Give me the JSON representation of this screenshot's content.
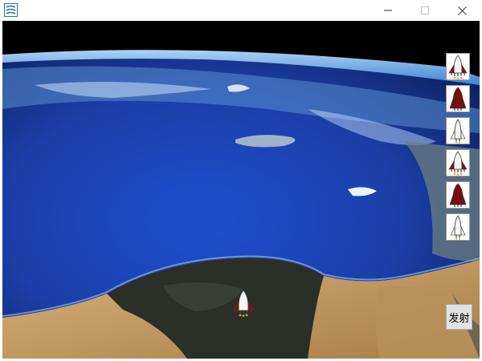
{
  "window": {
    "title": "",
    "icon": "app-icon",
    "controls": [
      "minimize-icon",
      "maximize-icon",
      "close-icon"
    ]
  },
  "enemy_ships": [
    {
      "icon": "shuttle-icon",
      "variant": "white-red"
    },
    {
      "icon": "shuttle-icon",
      "variant": "dark-red"
    },
    {
      "icon": "shuttle-icon",
      "variant": "white"
    },
    {
      "icon": "shuttle-icon",
      "variant": "white-red"
    },
    {
      "icon": "shuttle-icon",
      "variant": "dark-red"
    },
    {
      "icon": "shuttle-icon",
      "variant": "white"
    }
  ],
  "player_ship": {
    "icon": "shuttle-icon",
    "variant": "white-red"
  },
  "fire_button": {
    "label": "发射"
  },
  "colors": {
    "space": "#000000",
    "ocean": "#1e4fc4",
    "desert": "#c9a06a",
    "shuttle_red": "#8b1010",
    "button_face": "#e1e1e1"
  }
}
